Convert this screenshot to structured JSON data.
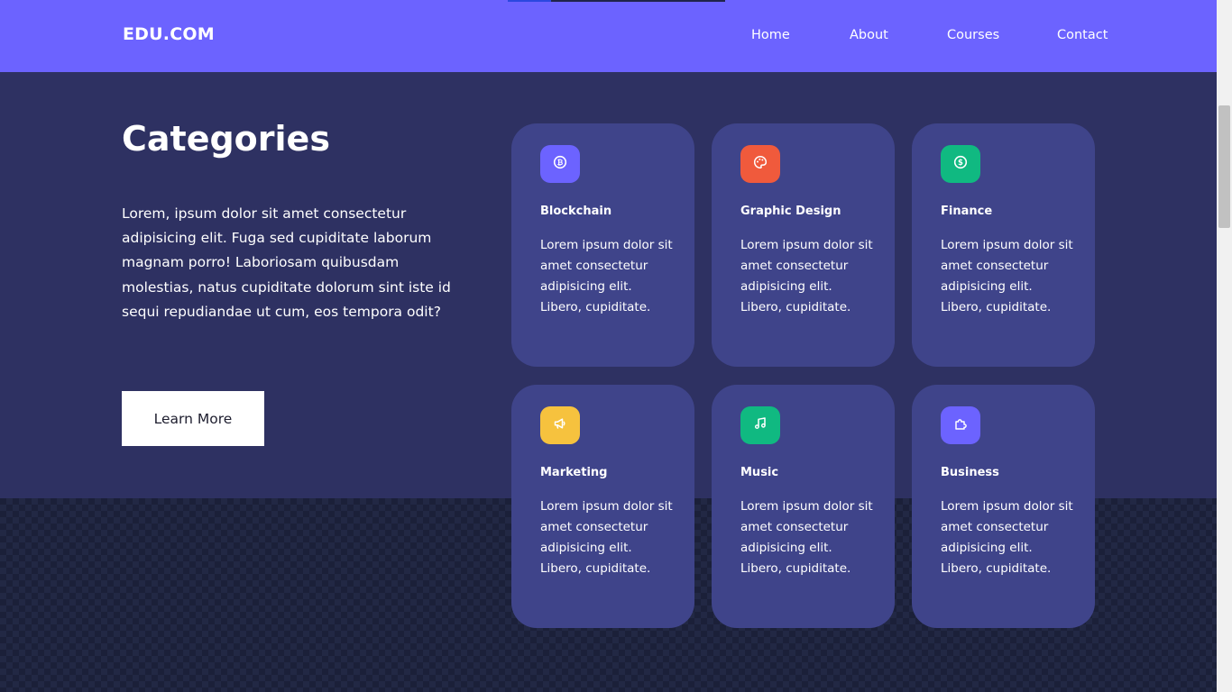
{
  "nav": {
    "logo": "EDU.COM",
    "links": [
      "Home",
      "About",
      "Courses",
      "Contact"
    ]
  },
  "hero": {
    "title": "Categories",
    "description": "Lorem, ipsum dolor sit amet consectetur adipisicing elit. Fuga sed cupiditate laborum magnam porro! Laboriosam quibusdam molestias, natus cupiditate dolorum sint iste id sequi repudiandae ut cum, eos tempora odit?",
    "button_label": "Learn More"
  },
  "categories": [
    {
      "title": "Blockchain",
      "text": "Lorem ipsum dolor sit amet consectetur adipisicing elit. Libero, cupiditate.",
      "icon": "bitcoin-icon",
      "color": "#6c63ff"
    },
    {
      "title": "Graphic Design",
      "text": "Lorem ipsum dolor sit amet consectetur adipisicing elit. Libero, cupiditate.",
      "icon": "palette-icon",
      "color": "#f05a3c"
    },
    {
      "title": "Finance",
      "text": "Lorem ipsum dolor sit amet consectetur adipisicing elit. Libero, cupiditate.",
      "icon": "dollar-icon",
      "color": "#10b981"
    },
    {
      "title": "Marketing",
      "text": "Lorem ipsum dolor sit amet consectetur adipisicing elit. Libero, cupiditate.",
      "icon": "megaphone-icon",
      "color": "#f6c23e"
    },
    {
      "title": "Music",
      "text": "Lorem ipsum dolor sit amet consectetur adipisicing elit. Libero, cupiditate.",
      "icon": "music-note-icon",
      "color": "#10b981"
    },
    {
      "title": "Business",
      "text": "Lorem ipsum dolor sit amet consectetur adipisicing elit. Libero, cupiditate.",
      "icon": "puzzle-icon",
      "color": "#6c63ff"
    }
  ]
}
